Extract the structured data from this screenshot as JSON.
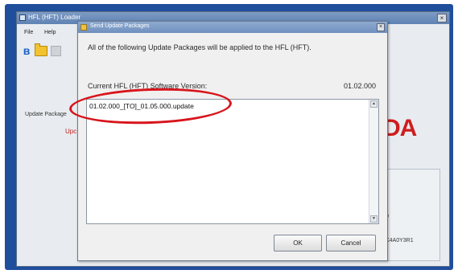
{
  "main_window": {
    "title": "HFL (HFT) Loader",
    "close_glyph": "×",
    "menu": [
      "File",
      "Help"
    ],
    "toolbar_icons": [
      "bluetooth-icon",
      "open-folder-icon",
      "disabled-tool-icon"
    ],
    "left_label": "Update Package",
    "left_status": "Upc",
    "brand_text": "DA",
    "right_text_1": "0",
    "right_text_2": "K4A0Y3R1"
  },
  "dialog": {
    "title": "Send Update Packages",
    "close_glyph": "×",
    "message": "All of the following Update Packages will be applied to the HFL (HFT).",
    "version_label": "Current HFL (HFT) Software Version:",
    "version_value": "01.02.000",
    "packages": [
      "01.02.000_[TO]_01.05.000.update"
    ],
    "ok_label": "OK",
    "cancel_label": "Cancel"
  },
  "colors": {
    "frame": "#1f4e9c",
    "brand": "#cf1d1d",
    "annotation": "#d8141b"
  }
}
